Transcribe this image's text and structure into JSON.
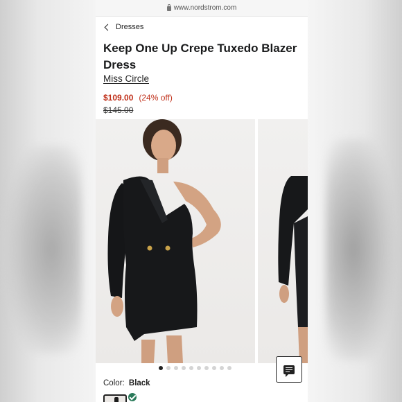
{
  "browser": {
    "url": "www.nordstrom.com"
  },
  "breadcrumb": {
    "label": "Dresses"
  },
  "product": {
    "title": "Keep One Up Crepe Tuxedo Blazer Dress",
    "brand": "Miss Circle",
    "sale_price": "$109.00",
    "discount": "(24% off)",
    "original_price": "$145.00"
  },
  "gallery": {
    "dot_count": 10,
    "active_index": 0
  },
  "color": {
    "label": "Color:",
    "value": "Black"
  },
  "colors": {
    "accent_sale": "#c0301a",
    "selected_check": "#2a7a5a"
  }
}
